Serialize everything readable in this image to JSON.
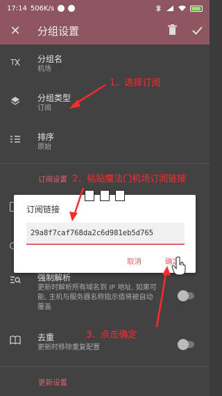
{
  "status_bar": {
    "time": "17:14",
    "network": "506K/s",
    "battery_level": 0.8
  },
  "app_bar": {
    "close_icon": "close-icon",
    "title": "分组设置",
    "delete_icon": "trash-icon",
    "confirm_icon": "check-icon"
  },
  "settings": {
    "group_name": {
      "label": "分组名",
      "value": "机场",
      "icon": "text-format-icon"
    },
    "group_type": {
      "label": "分组类型",
      "value": "订阅",
      "icon": "layers-icon"
    },
    "sort": {
      "label": "排序",
      "value": "原始",
      "icon": "sort-list-icon"
    },
    "subscription_section": "订阅设置",
    "force_resolve": {
      "label": "强制解析",
      "desc_line1": "更新时解析所有域名到 IP 地址, 如果可",
      "desc_line2": "能, 主机与服务器名称指示值将被自动",
      "desc_line3": "覆盖",
      "enabled": false
    },
    "dedupe": {
      "label": "去重",
      "desc": "更新时移除重复配置",
      "enabled": false
    },
    "update_section": "更新设置"
  },
  "dialog": {
    "title": "订阅链接",
    "input_value": "29a8f7caf768da2c6d981eb5d765",
    "cancel_label": "取消",
    "ok_label": "确定"
  },
  "annotations": {
    "step1": "1、选择订阅",
    "step2": "2、粘贴魔法门机场订阅链接",
    "step3": "3、点击确定"
  },
  "colors": {
    "app_bar": "#8e5660",
    "accent": "#e0606a",
    "annotation": "#ff2a2a"
  }
}
